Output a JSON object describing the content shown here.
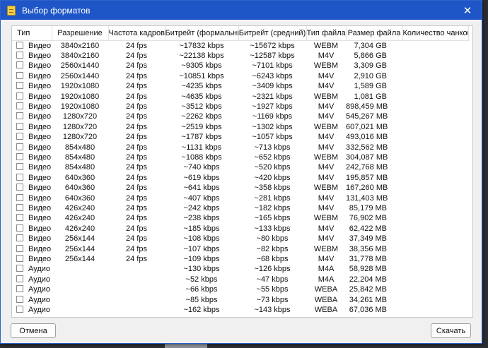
{
  "window": {
    "title": "Выбор форматов"
  },
  "columns": [
    "Тип",
    "Разрешение",
    "Частота кадров",
    "Битрейт (формальный)",
    "Битрейт (средний)",
    "Тип файла",
    "Размер файла",
    "Количество чанков"
  ],
  "rows": [
    [
      "Видео",
      "3840x2160",
      "24 fps",
      "~17832 kbps",
      "~15672 kbps",
      "WEBM",
      "7,304 GB",
      ""
    ],
    [
      "Видео",
      "3840x2160",
      "24 fps",
      "~22138 kbps",
      "~12587 kbps",
      "M4V",
      "5,866 GB",
      ""
    ],
    [
      "Видео",
      "2560x1440",
      "24 fps",
      "~9305 kbps",
      "~7101 kbps",
      "WEBM",
      "3,309 GB",
      ""
    ],
    [
      "Видео",
      "2560x1440",
      "24 fps",
      "~10851 kbps",
      "~6243 kbps",
      "M4V",
      "2,910 GB",
      ""
    ],
    [
      "Видео",
      "1920x1080",
      "24 fps",
      "~4235 kbps",
      "~3409 kbps",
      "M4V",
      "1,589 GB",
      ""
    ],
    [
      "Видео",
      "1920x1080",
      "24 fps",
      "~4635 kbps",
      "~2321 kbps",
      "WEBM",
      "1,081 GB",
      ""
    ],
    [
      "Видео",
      "1920x1080",
      "24 fps",
      "~3512 kbps",
      "~1927 kbps",
      "M4V",
      "898,459 MB",
      ""
    ],
    [
      "Видео",
      "1280x720",
      "24 fps",
      "~2262 kbps",
      "~1169 kbps",
      "M4V",
      "545,267 MB",
      ""
    ],
    [
      "Видео",
      "1280x720",
      "24 fps",
      "~2519 kbps",
      "~1302 kbps",
      "WEBM",
      "607,021 MB",
      ""
    ],
    [
      "Видео",
      "1280x720",
      "24 fps",
      "~1787 kbps",
      "~1057 kbps",
      "M4V",
      "493,016 MB",
      ""
    ],
    [
      "Видео",
      "854x480",
      "24 fps",
      "~1131 kbps",
      "~713 kbps",
      "M4V",
      "332,562 MB",
      ""
    ],
    [
      "Видео",
      "854x480",
      "24 fps",
      "~1088 kbps",
      "~652 kbps",
      "WEBM",
      "304,087 MB",
      ""
    ],
    [
      "Видео",
      "854x480",
      "24 fps",
      "~740 kbps",
      "~520 kbps",
      "M4V",
      "242,768 MB",
      ""
    ],
    [
      "Видео",
      "640x360",
      "24 fps",
      "~619 kbps",
      "~420 kbps",
      "M4V",
      "195,857 MB",
      ""
    ],
    [
      "Видео",
      "640x360",
      "24 fps",
      "~641 kbps",
      "~358 kbps",
      "WEBM",
      "167,260 MB",
      ""
    ],
    [
      "Видео",
      "640x360",
      "24 fps",
      "~407 kbps",
      "~281 kbps",
      "M4V",
      "131,403 MB",
      ""
    ],
    [
      "Видео",
      "426x240",
      "24 fps",
      "~242 kbps",
      "~182 kbps",
      "M4V",
      "85,179 MB",
      ""
    ],
    [
      "Видео",
      "426x240",
      "24 fps",
      "~238 kbps",
      "~165 kbps",
      "WEBM",
      "76,902 MB",
      ""
    ],
    [
      "Видео",
      "426x240",
      "24 fps",
      "~185 kbps",
      "~133 kbps",
      "M4V",
      "62,422 MB",
      ""
    ],
    [
      "Видео",
      "256x144",
      "24 fps",
      "~108 kbps",
      "~80 kbps",
      "M4V",
      "37,349 MB",
      ""
    ],
    [
      "Видео",
      "256x144",
      "24 fps",
      "~107 kbps",
      "~82 kbps",
      "WEBM",
      "38,356 MB",
      ""
    ],
    [
      "Видео",
      "256x144",
      "24 fps",
      "~109 kbps",
      "~68 kbps",
      "M4V",
      "31,778 MB",
      ""
    ],
    [
      "Аудио",
      "",
      "",
      "~130 kbps",
      "~126 kbps",
      "M4A",
      "58,928 MB",
      ""
    ],
    [
      "Аудио",
      "",
      "",
      "~52 kbps",
      "~47 kbps",
      "M4A",
      "22,204 MB",
      ""
    ],
    [
      "Аудио",
      "",
      "",
      "~66 kbps",
      "~55 kbps",
      "WEBA",
      "25,842 MB",
      ""
    ],
    [
      "Аудио",
      "",
      "",
      "~85 kbps",
      "~73 kbps",
      "WEBA",
      "34,261 MB",
      ""
    ],
    [
      "Аудио",
      "",
      "",
      "~162 kbps",
      "~143 kbps",
      "WEBA",
      "67,036 MB",
      ""
    ]
  ],
  "buttons": {
    "cancel": "Отмена",
    "download": "Скачать"
  },
  "colors": {
    "titlebar": "#1e56c8",
    "window_bg": "#f0f0f0"
  }
}
